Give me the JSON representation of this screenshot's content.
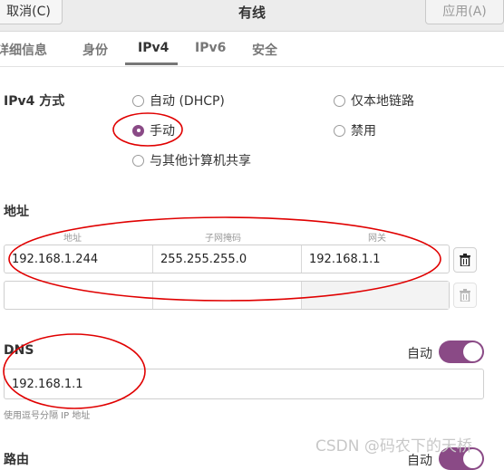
{
  "header": {
    "cancel_label": "取消(C)",
    "title": "有线",
    "apply_label": "应用(A)"
  },
  "tabs": [
    {
      "label": "详细信息"
    },
    {
      "label": "身份"
    },
    {
      "label": "IPv4"
    },
    {
      "label": "IPv6"
    },
    {
      "label": "安全"
    }
  ],
  "ipv4": {
    "method_label": "IPv4 方式",
    "options": [
      {
        "label": "自动 (DHCP)",
        "checked": false
      },
      {
        "label": "仅本地链路",
        "checked": false
      },
      {
        "label": "手动",
        "checked": true
      },
      {
        "label": "禁用",
        "checked": false
      },
      {
        "label": "与其他计算机共享",
        "checked": false
      }
    ]
  },
  "address": {
    "section_label": "地址",
    "columns": [
      "地址",
      "子网掩码",
      "网关"
    ],
    "rows": [
      [
        "192.168.1.244",
        "255.255.255.0",
        "192.168.1.1"
      ],
      [
        "",
        "",
        ""
      ]
    ]
  },
  "dns": {
    "label": "DNS",
    "auto_label": "自动",
    "auto_enabled": true,
    "value": "192.168.1.1",
    "hint": "使用逗号分隔 IP 地址"
  },
  "routes": {
    "label": "路由",
    "auto_label": "自动"
  },
  "watermark": "CSDN @码农下的天桥",
  "colors": {
    "accent": "#8a4a86",
    "annotation": "#e00000"
  }
}
